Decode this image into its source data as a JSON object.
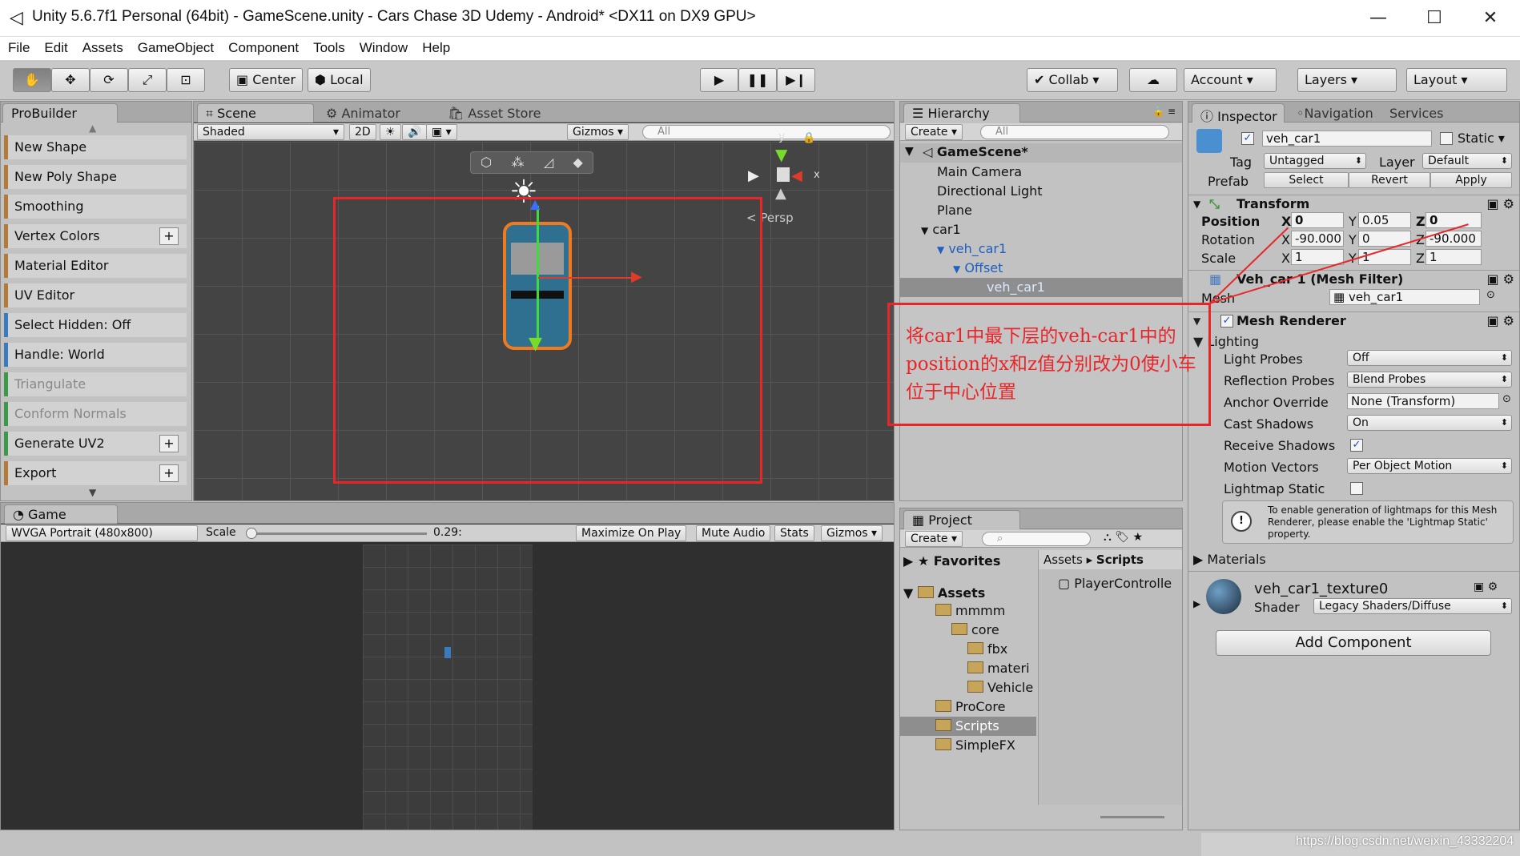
{
  "window": {
    "title": "Unity 5.6.7f1 Personal (64bit) - GameScene.unity - Cars Chase 3D Udemy - Android* <DX11 on DX9 GPU>"
  },
  "menu": [
    "File",
    "Edit",
    "Assets",
    "GameObject",
    "Component",
    "Tools",
    "Window",
    "Help"
  ],
  "toolbar": {
    "center": "Center",
    "local": "Local",
    "collab": "Collab",
    "account": "Account",
    "layers": "Layers",
    "layout": "Layout"
  },
  "probuilder": {
    "tab": "ProBuilder",
    "items": [
      "New Shape",
      "New Poly Shape",
      "Smoothing",
      "Vertex Colors",
      "Material Editor",
      "UV Editor",
      "Select Hidden: Off",
      "Handle: World",
      "Triangulate",
      "Conform Normals",
      "Generate UV2",
      "Export"
    ]
  },
  "scene": {
    "tabs": [
      "Scene",
      "Animator",
      "Asset Store"
    ],
    "shading": "Shaded",
    "mode2d": "2D",
    "gizmos": "Gizmos",
    "search": "All",
    "persp": "Persp",
    "axis_y": "y",
    "axis_x": "x"
  },
  "game": {
    "tab": "Game",
    "resolution": "WVGA Portrait (480x800)",
    "scale_label": "Scale",
    "scale_value": "0.29:",
    "maximize": "Maximize On Play",
    "mute": "Mute Audio",
    "stats": "Stats",
    "gizmos": "Gizmos"
  },
  "hierarchy": {
    "tab": "Hierarchy",
    "create": "Create",
    "search": "All",
    "scene": "GameScene*",
    "items": [
      "Main Camera",
      "Directional Light",
      "Plane",
      "car1",
      "veh_car1",
      "Offset",
      "veh_car1"
    ]
  },
  "project": {
    "tab": "Project",
    "create": "Create",
    "favorites": "Favorites",
    "assets": "Assets",
    "tree": [
      "mmmm",
      "core",
      "fbx",
      "materi",
      "Vehicle",
      "ProCore",
      "Scripts",
      "SimpleFX"
    ],
    "breadcrumb_root": "Assets",
    "breadcrumb_leaf": "Scripts",
    "file": "PlayerControlle"
  },
  "inspector": {
    "tabs": [
      "Inspector",
      "Navigation",
      "Services"
    ],
    "name": "veh_car1",
    "static": "Static",
    "tag_label": "Tag",
    "tag": "Untagged",
    "layer_label": "Layer",
    "layer": "Default",
    "prefab_label": "Prefab",
    "select": "Select",
    "revert": "Revert",
    "apply": "Apply",
    "transform": "Transform",
    "position_label": "Position",
    "rotation_label": "Rotation",
    "scale_label": "Scale",
    "x": "X",
    "y": "Y",
    "z": "Z",
    "pos": [
      "0",
      "0.05",
      "0"
    ],
    "rot": [
      "-90.000",
      "0",
      "-90.000"
    ],
    "scl": [
      "1",
      "1",
      "1"
    ],
    "mesh_filter": "Veh_car 1 (Mesh Filter)",
    "mesh_label": "Mesh",
    "mesh": "veh_car1",
    "mesh_renderer": "Mesh Renderer",
    "lighting": "Lighting",
    "props": [
      {
        "label": "Light Probes",
        "value": "Off"
      },
      {
        "label": "Reflection Probes",
        "value": "Blend Probes"
      },
      {
        "label": "Anchor Override",
        "value": "None (Transform)"
      },
      {
        "label": "Cast Shadows",
        "value": "On"
      },
      {
        "label": "Receive Shadows",
        "value": "✓"
      },
      {
        "label": "Motion Vectors",
        "value": "Per Object Motion"
      },
      {
        "label": "Lightmap Static",
        "value": ""
      }
    ],
    "help": "To enable generation of lightmaps for this Mesh Renderer, please enable the 'Lightmap Static' property.",
    "materials": "Materials",
    "material_name": "veh_car1_texture0",
    "shader_label": "Shader",
    "shader": "Legacy Shaders/Diffuse",
    "add_component": "Add Component"
  },
  "annotation": {
    "text": "将car1中最下层的veh-car1中的position的x和z值分别改为0使小车位于中心位置"
  },
  "watermark": "https://blog.csdn.net/weixin_43332204"
}
